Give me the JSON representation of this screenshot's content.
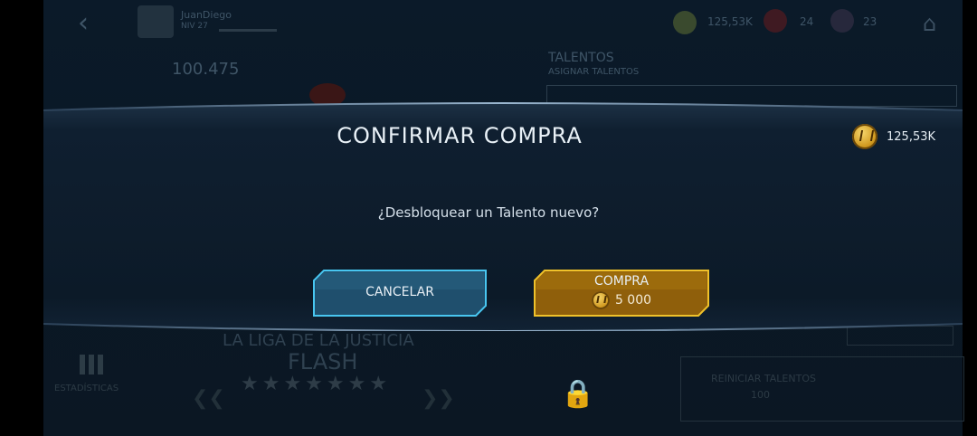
{
  "background": {
    "player_name": "JuanDiego",
    "player_level": "NIV 27",
    "top_currency_value": "125,53K",
    "energy_value": "24",
    "shield_value": "23",
    "power_value": "100.475",
    "talents_title": "TALENTOS",
    "talents_subtitle": "ASIGNAR TALENTOS",
    "team_label": "LA LIGA DE LA JUSTICIA",
    "hero_name": "FLASH",
    "stats_label": "ESTADÍSTICAS",
    "talent_reset_label": "REINICIAR TALENTOS",
    "talent_reset_value": "100"
  },
  "modal": {
    "title": "CONFIRMAR COMPRA",
    "currency_value": "125,53K",
    "question": "¿Desbloquear un Talento nuevo?",
    "cancel_label": "CANCELAR",
    "buy_label": "COMPRA",
    "buy_price": "5 000"
  },
  "colors": {
    "cancel_border": "#48c6f0",
    "buy_border": "#f0c22a",
    "buy_fill": "#8f5f0b",
    "modal_edge": "#8aa9c3"
  }
}
